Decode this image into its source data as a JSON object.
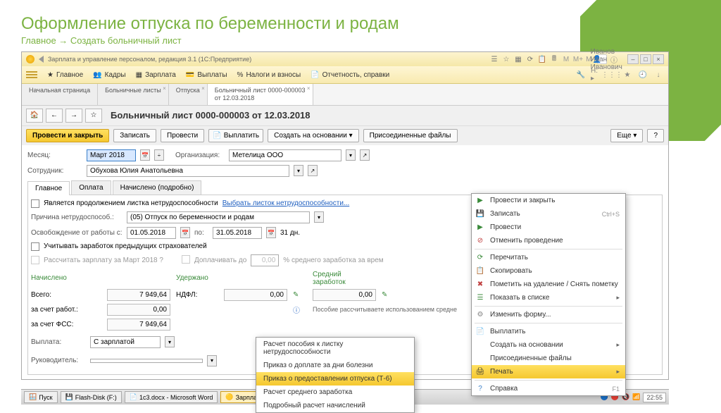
{
  "slide": {
    "title": "Оформление отпуска по беременности и родам",
    "subtitle": "Главное → Создать больничный лист"
  },
  "titlebar": {
    "text": "Зарплата и управление персоналом, редакция 3.1  (1С:Предприятие)",
    "user": "Иванов Иван Иванович"
  },
  "mainmenu": {
    "items": [
      "Главное",
      "Кадры",
      "Зарплата",
      "Выплаты",
      "Налоги и взносы",
      "Отчетность, справки"
    ],
    "percent": "%"
  },
  "tabs": {
    "start": "Начальная страница",
    "sick": "Больничные листы",
    "vac": "Отпуска",
    "doc1": "Больничный лист 0000-000003",
    "doc2": "от 12.03.2018"
  },
  "doc": {
    "title": "Больничный лист 0000-000003 от 12.03.2018",
    "btn_run_close": "Провести и закрыть",
    "btn_write": "Записать",
    "btn_run": "Провести",
    "btn_pay": "Выплатить",
    "btn_create": "Создать на основании",
    "btn_files": "Присоединенные файлы",
    "btn_more": "Еще",
    "month_label": "Месяц:",
    "month_value": "Март 2018",
    "org_label": "Организация:",
    "org_value": "Метелица ООО",
    "emp_label": "Сотрудник:",
    "emp_value": "Обухова Юлия Анатольевна"
  },
  "inner_tabs": {
    "t1": "Главное",
    "t2": "Оплата",
    "t3": "Начислено (подробно)"
  },
  "body": {
    "cont_label": "Является продолжением листка нетрудоспособности",
    "cont_link": "Выбрать листок нетрудоспособности...",
    "reason_label": "Причина нетрудоспособ.:",
    "reason_value": "(05) Отпуск по беременности и родам",
    "release_label": "Освобождение от работы с:",
    "date_from": "01.05.2018",
    "date_to_label": "по:",
    "date_to": "31.05.2018",
    "days": "31 дн.",
    "prev_ins": "Учитывать заработок предыдущих страхователей",
    "calc_label": "Рассчитать зарплату за Март 2018 ?",
    "topup_label": "Доплачивать до",
    "topup_val": "0,00",
    "topup_pct": "% среднего заработка за врем",
    "h_accrued": "Начислено",
    "h_withheld": "Удержано",
    "h_avg": "Средний заработок",
    "r_total": "Всего:",
    "r_emp": "за счет работ.:",
    "r_fss": "за счет ФСС:",
    "v_total": "7 949,64",
    "v_emp": "0,00",
    "v_fss": "7 949,64",
    "ndfl": "НДФЛ:",
    "ndfl_v": "0,00",
    "avg_v": "0,00",
    "info": "Пособие рассчитываете использованием средне",
    "payout_label": "Выплата:",
    "payout_value": "С зарплатой",
    "mgr_label": "Руководитель:"
  },
  "cm": {
    "i1": "Провести и закрыть",
    "i2": "Записать",
    "k2": "Ctrl+S",
    "i3": "Провести",
    "i4": "Отменить проведение",
    "i5": "Перечитать",
    "i6": "Скопировать",
    "i7": "Пометить на удаление / Снять пометку",
    "i8": "Показать в списке",
    "i9": "Изменить форму...",
    "i10": "Выплатить",
    "i11": "Создать на основании",
    "i12": "Присоединенные файлы",
    "i13": "Печать",
    "i14": "Справка",
    "k14": "F1"
  },
  "submenu": {
    "s1": "Расчет пособия к листку нетрудоспособности",
    "s2": "Приказ о доплате за дни болезни",
    "s3": "Приказ о предоставлении отпуска (Т-6)",
    "s4": "Расчет среднего заработка",
    "s5": "Подробный расчет начислений"
  },
  "taskbar": {
    "start": "Пуск",
    "flash": "Flash-Disk (F:)",
    "word": "1с3.docx - Microsoft Word",
    "app": "Зарплата и управле...",
    "time": "22:55"
  }
}
